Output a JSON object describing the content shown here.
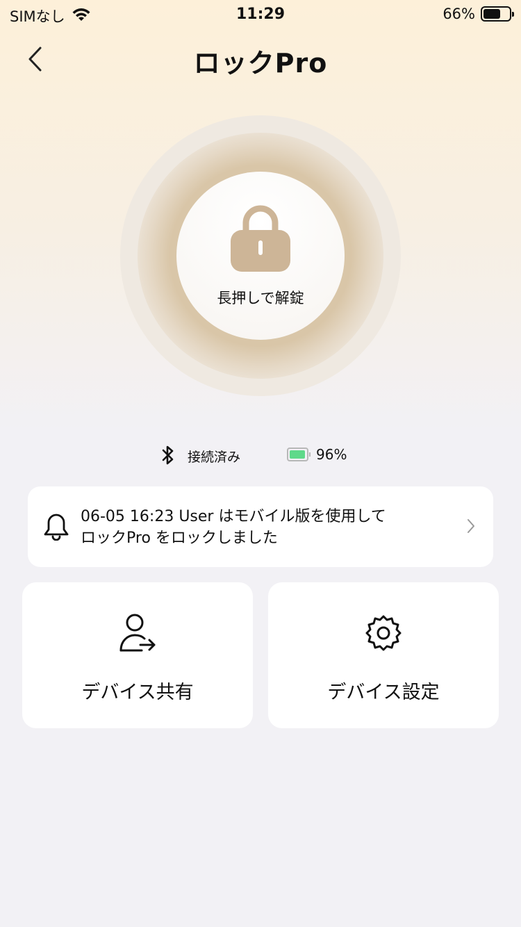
{
  "status_bar": {
    "carrier": "SIMなし",
    "time": "11:29",
    "battery_percent": "66%",
    "battery_level": 0.66
  },
  "header": {
    "title": "ロックPro"
  },
  "lock": {
    "hint": "長押しで解錠",
    "color": "#cdb597"
  },
  "connection": {
    "status": "接続済み",
    "battery": "96%",
    "battery_level": 0.96,
    "battery_color": "#5fd98a"
  },
  "notice": {
    "line1": "06-05 16:23 User はモバイル版を使用して",
    "line2": "ロックPro  をロックしました"
  },
  "actions": {
    "share_label": "デバイス共有",
    "settings_label": "デバイス設定"
  }
}
